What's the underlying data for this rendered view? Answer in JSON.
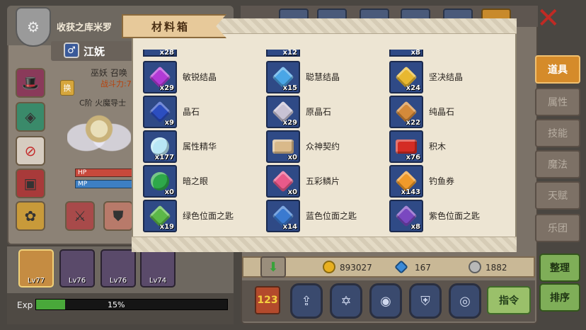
{
  "character": {
    "title": "收获之库米罗",
    "name": "江妩",
    "class": "巫妖 召唤",
    "power_label": "战斗力:7",
    "rank": "C阶 火魔导士",
    "hp_label": "HP",
    "mp_label": "MP"
  },
  "party": [
    {
      "level": "Lv77"
    },
    {
      "level": "Lv76"
    },
    {
      "level": "Lv76"
    },
    {
      "level": "Lv74"
    }
  ],
  "exp": {
    "label": "Exp",
    "percent_text": "15%",
    "fraction": 0.15
  },
  "material_box": {
    "title": "材料箱",
    "partial_top": [
      {
        "count": "x28"
      },
      {
        "count": "x12"
      },
      {
        "count": "x8"
      }
    ],
    "items": [
      {
        "name": "敏锐结晶",
        "count": "x29",
        "icon": "purple-crystal-icon",
        "color": "#b23ad6"
      },
      {
        "name": "聪慧结晶",
        "count": "x15",
        "icon": "blue-crystal-icon",
        "color": "#4aa6e6"
      },
      {
        "name": "坚决结晶",
        "count": "x24",
        "icon": "yellow-crystal-icon",
        "color": "#e8b830"
      },
      {
        "name": "晶石",
        "count": "x9",
        "icon": "blue-ore-icon",
        "color": "#2c4ec0"
      },
      {
        "name": "原晶石",
        "count": "x29",
        "icon": "raw-ore-icon",
        "color": "#c8c2d4"
      },
      {
        "name": "纯晶石",
        "count": "x22",
        "icon": "pure-ore-icon",
        "color": "#d48a3a"
      },
      {
        "name": "属性精华",
        "count": "x177",
        "icon": "essence-orb-icon",
        "color": "#b8e6f5"
      },
      {
        "name": "众神契约",
        "count": "x0",
        "icon": "scroll-icon",
        "color": "#d9b98a"
      },
      {
        "name": "积木",
        "count": "x76",
        "icon": "brick-icon",
        "color": "#d42c24"
      },
      {
        "name": "暗之眼",
        "count": "x0",
        "icon": "dark-eye-icon",
        "color": "#2ea84a"
      },
      {
        "name": "五彩鳞片",
        "count": "x0",
        "icon": "rainbow-scale-icon",
        "color": "#e85a8a"
      },
      {
        "name": "钓鱼券",
        "count": "x143",
        "icon": "goldfish-icon",
        "color": "#f09a2a"
      },
      {
        "name": "绿色位面之匙",
        "count": "x19",
        "icon": "green-key-icon",
        "color": "#5cb848"
      },
      {
        "name": "蓝色位面之匙",
        "count": "x14",
        "icon": "blue-key-icon",
        "color": "#3a7ad0"
      },
      {
        "name": "紫色位面之匙",
        "count": "x8",
        "icon": "purple-key-icon",
        "color": "#7a48c0"
      }
    ]
  },
  "side_tabs": [
    {
      "label": "道具",
      "active": true
    },
    {
      "label": "属性",
      "active": false
    },
    {
      "label": "技能",
      "active": false
    },
    {
      "label": "魔法",
      "active": false
    },
    {
      "label": "天赋",
      "active": false
    },
    {
      "label": "乐团",
      "active": false
    }
  ],
  "currency": {
    "gold": "893027",
    "diamond": "167",
    "silver": "1882"
  },
  "buttons": {
    "command": "指令",
    "organize": "整理",
    "sort": "排序",
    "number": "123"
  }
}
